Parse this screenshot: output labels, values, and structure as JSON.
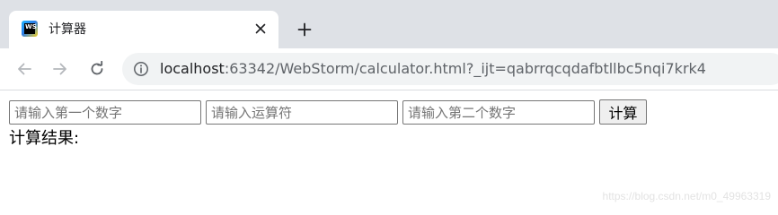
{
  "tab": {
    "title": "计算器",
    "favicon_text": "WS",
    "close_icon": "close-icon"
  },
  "toolbar": {
    "back_icon": "arrow-left-icon",
    "forward_icon": "arrow-right-icon",
    "reload_icon": "reload-icon",
    "info_icon": "info-icon",
    "url_host": "localhost",
    "url_rest": ":63342/WebStorm/calculator.html?_ijt=qabrrqcqdafbtllbc5nqi7krk4"
  },
  "form": {
    "first_number_placeholder": "请输入第一个数字",
    "first_number_value": "",
    "operator_placeholder": "请输入运算符",
    "operator_value": "",
    "second_number_placeholder": "请输入第二个数字",
    "second_number_value": "",
    "calculate_label": "计算",
    "result_label": "计算结果:"
  },
  "watermark": "https://blog.csdn.net/m0_49963319",
  "colors": {
    "tabstrip_bg": "#dee1e6",
    "omnibox_bg": "#f1f3f4",
    "icon_gray": "#5f6368"
  }
}
